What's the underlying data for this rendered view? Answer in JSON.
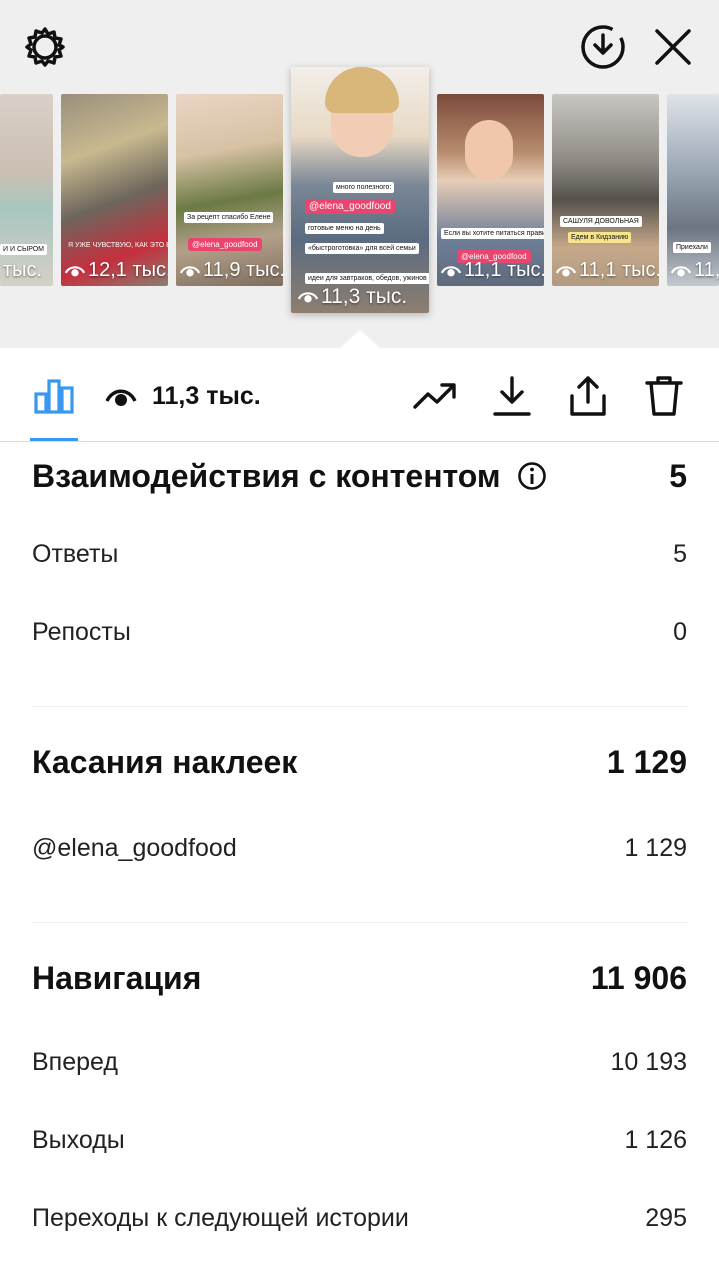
{
  "viewer": {
    "thumbnails": [
      {
        "views": "тыс.",
        "caption": "И И СЫРОМ",
        "tag": ""
      },
      {
        "views": "12,1 тыс.",
        "caption": "Я УЖЕ ЧУВСТВУЮ, КАК ЭТО ВКУСНО",
        "tag": ""
      },
      {
        "views": "11,9 тыс.",
        "caption": "За рецепт спасибо Елене",
        "tag": "@elena_goodfood"
      },
      {
        "views": "11,3 тыс.",
        "caption": "много полезного:",
        "tag": "@elena_goodfood"
      },
      {
        "views": "11,1 тыс.",
        "caption": "Если вы хотите питаться правильно",
        "tag": "@elena_goodfood"
      },
      {
        "views": "11,1 тыс.",
        "caption": "САШУЛЯ ДОВОЛЬНАЯ",
        "tag": "Едем в Кидзанию"
      },
      {
        "views": "11,",
        "caption": "Приехали",
        "tag": ""
      }
    ],
    "selected_lines": [
      "готовые меню на день",
      "«быстроготовка» для всей семьи",
      "идеи для завтраков, обедов, ужинов"
    ]
  },
  "toolbar": {
    "views": "11,3 тыс."
  },
  "sections": [
    {
      "title": "Взаимодействия с контентом",
      "value": "5",
      "info_icon": "info-icon",
      "rows": [
        {
          "label": "Ответы",
          "value": "5"
        },
        {
          "label": "Репосты",
          "value": "0"
        }
      ]
    },
    {
      "title": "Касания наклеек",
      "value": "1 129",
      "rows": [
        {
          "label": "@elena_goodfood",
          "value": "1 129"
        }
      ]
    },
    {
      "title": "Навигация",
      "value": "11 906",
      "rows": [
        {
          "label": "Вперед",
          "value": "10 193"
        },
        {
          "label": "Выходы",
          "value": "1 126"
        },
        {
          "label": "Переходы к следующей истории",
          "value": "295"
        }
      ]
    }
  ],
  "colors": {
    "accent": "#3897f0",
    "tag": "#e9456f",
    "viewer_bg": "#efefef"
  }
}
